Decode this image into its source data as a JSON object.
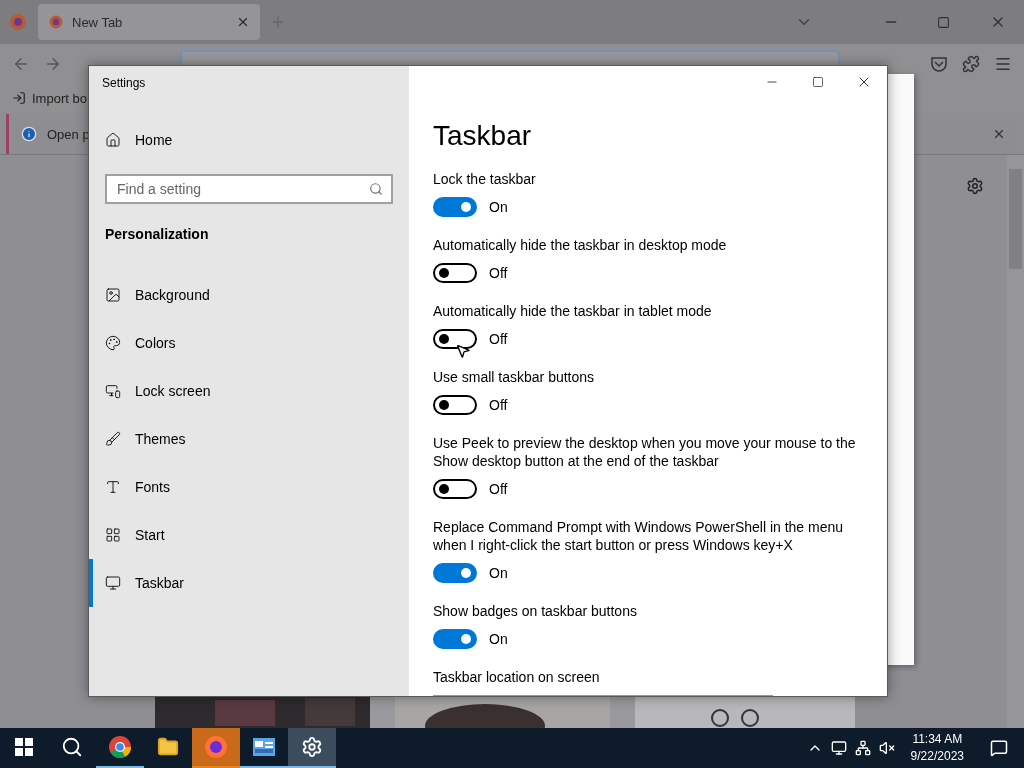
{
  "browser": {
    "tabs": [
      {
        "label": "New Tab",
        "selected": true
      }
    ],
    "bookmarks": [
      {
        "label": "Import bo"
      }
    ],
    "notification": {
      "text": "Open p"
    }
  },
  "settings_window": {
    "title": "Settings",
    "home": "Home",
    "search": {
      "placeholder": "Find a setting"
    },
    "section": "Personalization",
    "nav": [
      {
        "label": "Background",
        "selected": false
      },
      {
        "label": "Colors",
        "selected": false
      },
      {
        "label": "Lock screen",
        "selected": false
      },
      {
        "label": "Themes",
        "selected": false
      },
      {
        "label": "Fonts",
        "selected": false
      },
      {
        "label": "Start",
        "selected": false
      },
      {
        "label": "Taskbar",
        "selected": true
      }
    ],
    "page_title": "Taskbar",
    "settings": [
      {
        "kind": "toggle",
        "label": "Lock the taskbar",
        "on": true,
        "state_text": "On"
      },
      {
        "kind": "toggle",
        "label": "Automatically hide the taskbar in desktop mode",
        "on": false,
        "state_text": "Off"
      },
      {
        "kind": "toggle",
        "label": "Automatically hide the taskbar in tablet mode",
        "on": false,
        "state_text": "Off"
      },
      {
        "kind": "toggle",
        "label": "Use small taskbar buttons",
        "on": false,
        "state_text": "Off"
      },
      {
        "kind": "toggle",
        "label": "Use Peek to preview the desktop when you move your mouse to the Show desktop button at the end of the taskbar",
        "on": false,
        "state_text": "Off"
      },
      {
        "kind": "toggle",
        "label": "Replace Command Prompt with Windows PowerShell in the menu when I right-click the start button or press Windows key+X",
        "on": true,
        "state_text": "On"
      },
      {
        "kind": "toggle",
        "label": "Show badges on taskbar buttons",
        "on": true,
        "state_text": "On"
      },
      {
        "kind": "dropdown",
        "label": "Taskbar location on screen"
      }
    ]
  },
  "taskbar": {
    "apps": [
      {
        "kind": "chrome",
        "running": true,
        "flashing": false,
        "selected": false
      },
      {
        "kind": "explorer",
        "running": false,
        "flashing": false,
        "selected": false
      },
      {
        "kind": "firefox",
        "running": true,
        "flashing": true,
        "selected": false
      },
      {
        "kind": "control",
        "running": true,
        "flashing": false,
        "selected": false
      },
      {
        "kind": "settings",
        "running": true,
        "flashing": false,
        "selected": true
      }
    ],
    "time": "11:34 AM",
    "date": "9/22/2023"
  }
}
